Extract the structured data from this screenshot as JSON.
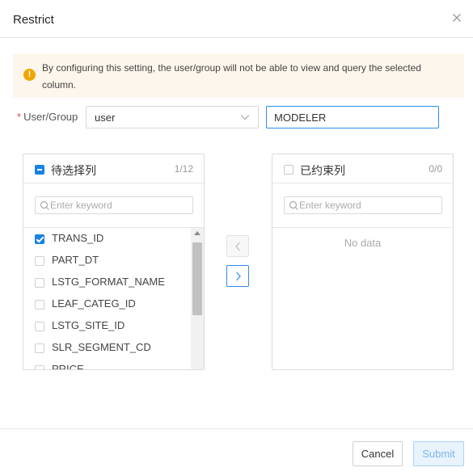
{
  "dialog": {
    "title": "Restrict",
    "close_icon": "close-icon"
  },
  "alert": {
    "icon": "warning-icon",
    "text": "By configuring this setting, the user/group will not be able to view and query the selected column."
  },
  "form": {
    "required_mark": "*",
    "user_group_label": "User/Group",
    "type_select_value": "user",
    "name_input_value": "MODELER"
  },
  "left_panel": {
    "title": "待选择列",
    "count": "1/12",
    "header_check_state": "indeterminate",
    "search_placeholder": "Enter keyword",
    "items": [
      {
        "label": "TRANS_ID",
        "checked": true
      },
      {
        "label": "PART_DT",
        "checked": false
      },
      {
        "label": "LSTG_FORMAT_NAME",
        "checked": false
      },
      {
        "label": "LEAF_CATEG_ID",
        "checked": false
      },
      {
        "label": "LSTG_SITE_ID",
        "checked": false
      },
      {
        "label": "SLR_SEGMENT_CD",
        "checked": false
      },
      {
        "label": "PRICE",
        "checked": false
      }
    ]
  },
  "right_panel": {
    "title": "已约束列",
    "count": "0/0",
    "search_placeholder": "Enter keyword",
    "empty_text": "No data"
  },
  "footer": {
    "cancel_label": "Cancel",
    "submit_label": "Submit"
  },
  "colors": {
    "accent": "#1a82e2",
    "warning": "#f0a500",
    "alert_bg": "#fdf6ec",
    "required": "#e5484d"
  }
}
